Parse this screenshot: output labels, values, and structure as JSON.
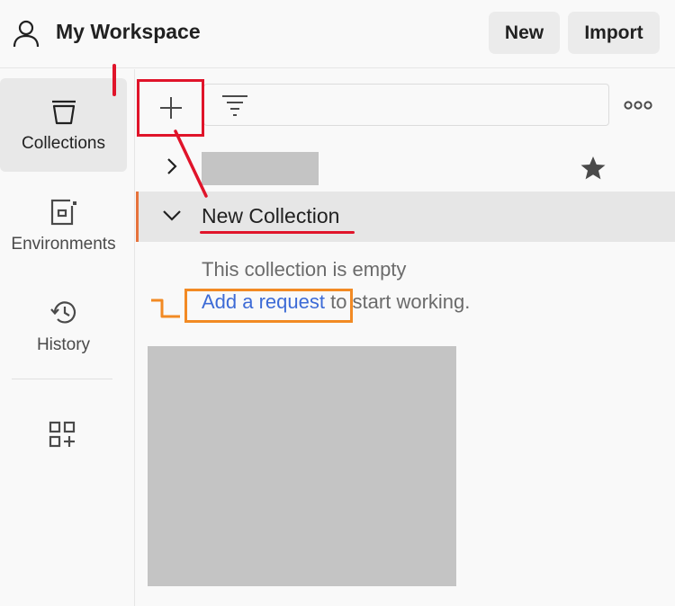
{
  "header": {
    "workspace_title": "My Workspace",
    "new_label": "New",
    "import_label": "Import"
  },
  "sidebar": {
    "items": [
      {
        "label": "Collections",
        "icon": "collections-icon",
        "active": true
      },
      {
        "label": "Environments",
        "icon": "environments-icon",
        "active": false
      },
      {
        "label": "History",
        "icon": "history-icon",
        "active": false
      }
    ],
    "configure_icon": "configure-workbench-icon"
  },
  "toolbar": {
    "plus_icon": "plus-icon",
    "filter_icon": "filter-icon",
    "search_placeholder": "",
    "more_icon": "more-options-icon"
  },
  "collections": [
    {
      "name_redacted": true,
      "expanded": false,
      "starred": true
    },
    {
      "name": "New Collection",
      "expanded": true,
      "empty_message": "This collection is empty",
      "add_request_link": "Add a request",
      "add_request_suffix": " to start working."
    }
  ],
  "colors": {
    "accent_link": "#3d6bd6",
    "annotation_red": "#e0142a",
    "annotation_orange": "#f28a24",
    "active_marker": "#e6733c"
  }
}
